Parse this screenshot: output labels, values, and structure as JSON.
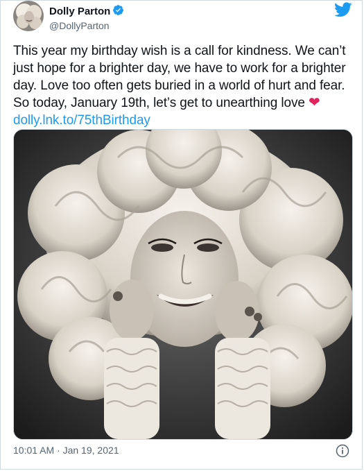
{
  "author": {
    "display_name": "Dolly Parton",
    "handle": "@DollyParton",
    "verified": true
  },
  "tweet": {
    "text": "This year my birthday wish is a call for kindness. We can’t just hope for a brighter day, we have to work for a brighter day. Love too often gets buried in a world of hurt and fear. So today, January 19th, let’s get to unearthing love",
    "emoji": "❤",
    "link": "dolly.lnk.to/75thBirthday"
  },
  "timestamp": "10:01 AM · Jan 19, 2021",
  "icons": {
    "verified": "verified-badge-icon",
    "brand": "twitter-bird-icon",
    "info": "info-icon"
  },
  "colors": {
    "link": "#1d9bf0",
    "heart": "#e0245e",
    "muted": "#536471",
    "text": "#0f1419"
  }
}
